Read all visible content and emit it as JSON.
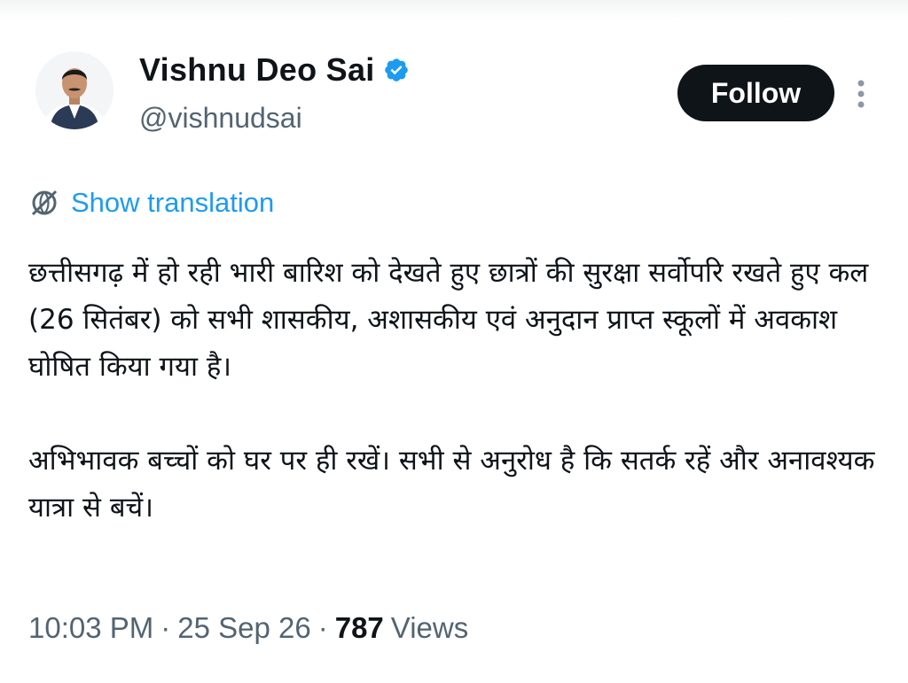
{
  "author": {
    "name": "Vishnu Deo Sai",
    "handle": "@vishnudsai",
    "verified_color": "#1d9bf0"
  },
  "actions": {
    "follow_label": "Follow",
    "more_icon": "vertical-ellipsis-icon"
  },
  "translation": {
    "icon": "globe-icon",
    "label": "Show translation"
  },
  "tweet": {
    "paragraph_1": "छत्तीसगढ़ में हो रही भारी बारिश को देखते हुए छात्रों की सुरक्षा सर्वोपरि रखते हुए कल (26 सितंबर) को सभी शासकीय, अशासकीय एवं अनुदान प्राप्त स्कूलों में अवकाश घोषित किया गया है।",
    "paragraph_2": "अभिभावक बच्चों को घर पर ही रखें। सभी से अनुरोध है कि सतर्क रहें और अनावश्यक यात्रा से बचें।"
  },
  "meta": {
    "time": "10:03 PM",
    "separator": "·",
    "date": "25 Sep 26",
    "views_count": "787",
    "views_label": "Views"
  },
  "colors": {
    "text": "#0f1419",
    "secondary": "#536471",
    "link": "#1d9bf0",
    "button": "#0f1419"
  }
}
